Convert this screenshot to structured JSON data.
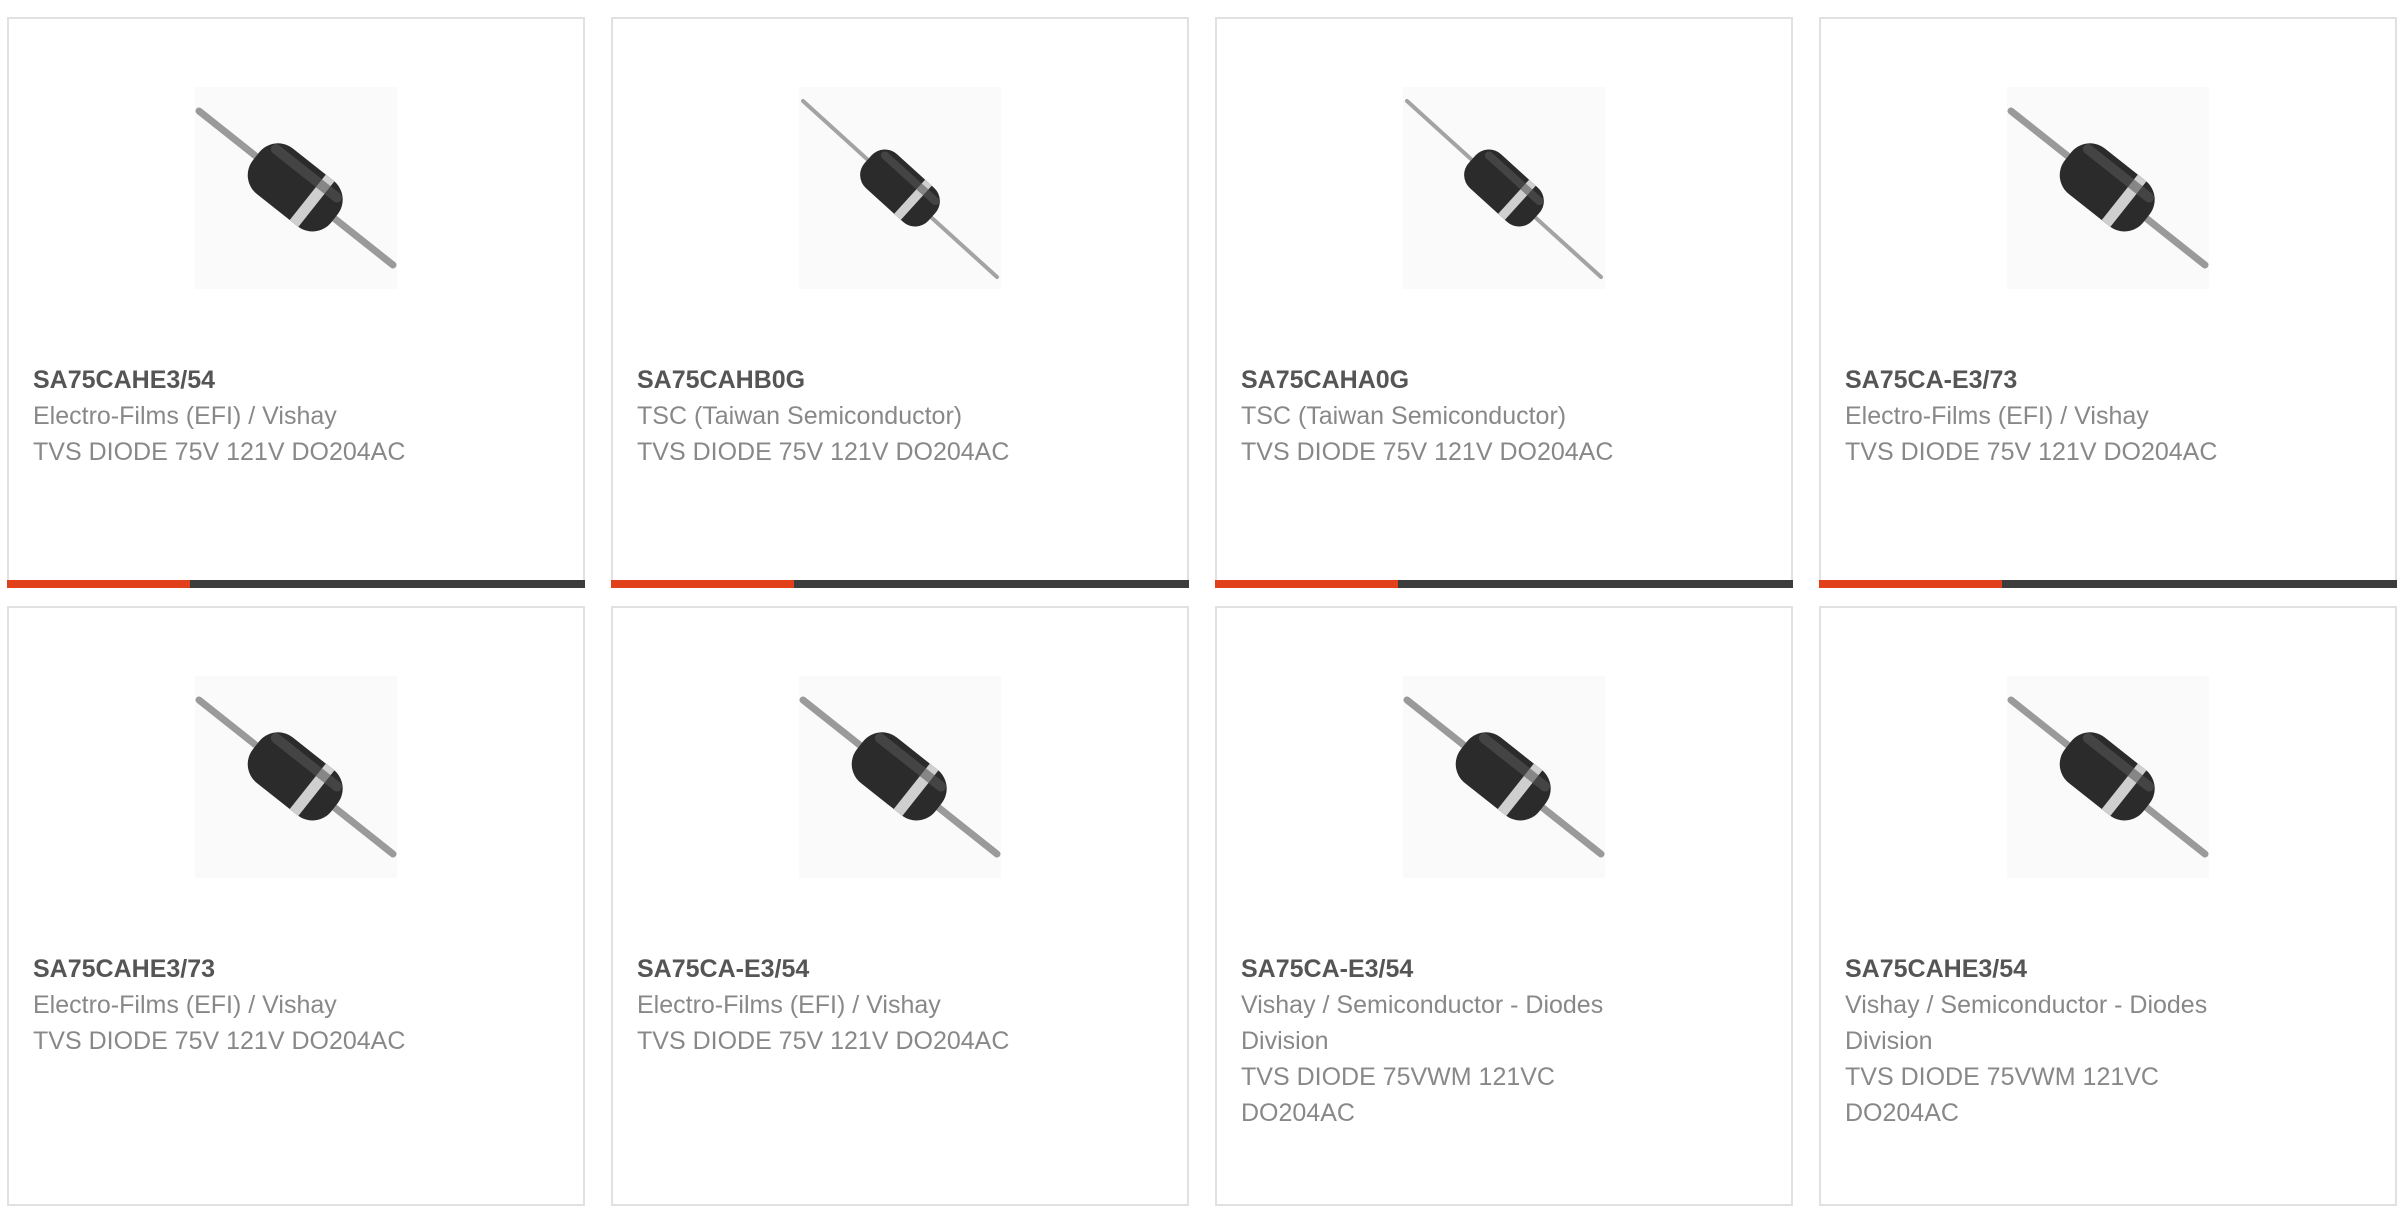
{
  "products": [
    {
      "part": "SA75CAHE3/54",
      "manufacturer": "Electro-Films (EFI) / Vishay",
      "description": "TVS DIODE 75V 121V DO204AC",
      "image_icon": "axial-diode-image"
    },
    {
      "part": "SA75CAHB0G",
      "manufacturer": "TSC (Taiwan Semiconductor)",
      "description": "TVS DIODE 75V 121V DO204AC",
      "image_icon": "axial-diode-image"
    },
    {
      "part": "SA75CAHA0G",
      "manufacturer": "TSC (Taiwan Semiconductor)",
      "description": "TVS DIODE 75V 121V DO204AC",
      "image_icon": "axial-diode-image"
    },
    {
      "part": "SA75CA-E3/73",
      "manufacturer": "Electro-Films (EFI) / Vishay",
      "description": "TVS DIODE 75V 121V DO204AC",
      "image_icon": "axial-diode-image"
    },
    {
      "part": "SA75CAHE3/73",
      "manufacturer": "Electro-Films (EFI) / Vishay",
      "description": "TVS DIODE 75V 121V DO204AC",
      "image_icon": "axial-diode-image"
    },
    {
      "part": "SA75CA-E3/54",
      "manufacturer": "Electro-Films (EFI) / Vishay",
      "description": "TVS DIODE 75V 121V DO204AC",
      "image_icon": "axial-diode-image"
    },
    {
      "part": "SA75CA-E3/54",
      "manufacturer": "Vishay / Semiconductor - Diodes Division",
      "description": "TVS DIODE 75VWM 121VC DO204AC",
      "image_icon": "axial-diode-image"
    },
    {
      "part": "SA75CAHE3/54",
      "manufacturer": "Vishay / Semiconductor - Diodes Division",
      "description": "TVS DIODE 75VWM 121VC DO204AC",
      "image_icon": "axial-diode-image"
    }
  ],
  "colors": {
    "accent": "#e2401b",
    "bar": "#3c3c3c",
    "part_text": "#555555",
    "secondary_text": "#888888",
    "card_border": "#e1e1e1"
  }
}
